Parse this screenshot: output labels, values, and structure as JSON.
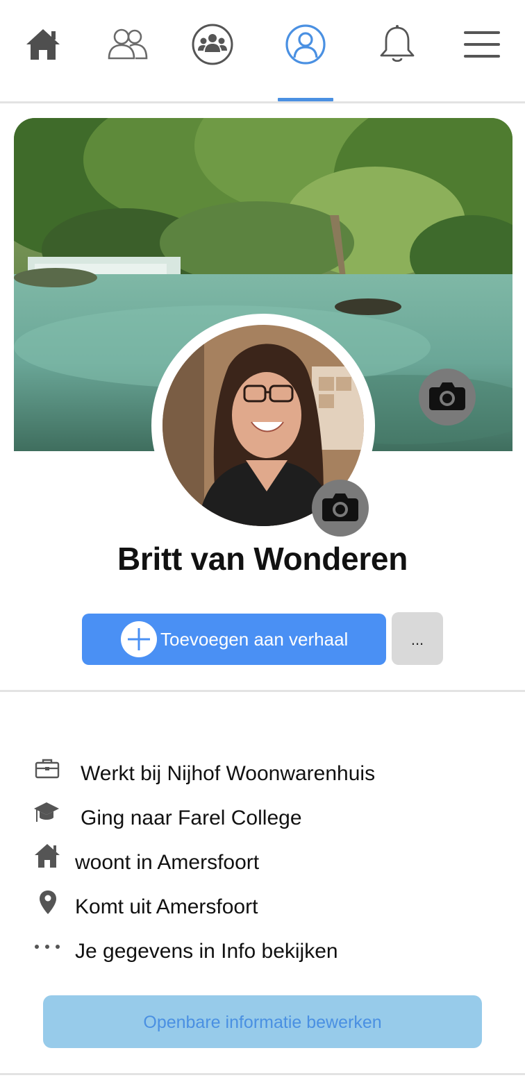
{
  "nav": {
    "items": [
      {
        "icon": "home-icon"
      },
      {
        "icon": "friends-icon"
      },
      {
        "icon": "groups-icon"
      },
      {
        "icon": "profile-icon",
        "active": true
      },
      {
        "icon": "bell-icon"
      },
      {
        "icon": "menu-icon"
      }
    ],
    "active_color": "#4a90e2",
    "icon_color": "#555555"
  },
  "profile": {
    "name": "Britt van Wonderen"
  },
  "actions": {
    "add_story_label": "Toevoegen aan verhaal",
    "more_label": "...",
    "primary_color": "#4a90f4"
  },
  "info": {
    "items": [
      {
        "icon": "briefcase-icon",
        "prefix": "Werkt bij ",
        "emphasis": "Nijhof Woonwarenhuis"
      },
      {
        "icon": "graduation-cap-icon",
        "prefix": "Ging naar Farel College",
        "emphasis": ""
      },
      {
        "icon": "home-icon",
        "prefix": "woont in ",
        "emphasis": "Amersfoort"
      },
      {
        "icon": "location-pin-icon",
        "prefix": "Komt uit ",
        "emphasis": "Amersfoort"
      },
      {
        "icon": "more-dots-icon",
        "prefix": "Je gegevens in Info bekijken",
        "emphasis": ""
      }
    ],
    "edit_button_label": "Openbare informatie bewerken"
  }
}
